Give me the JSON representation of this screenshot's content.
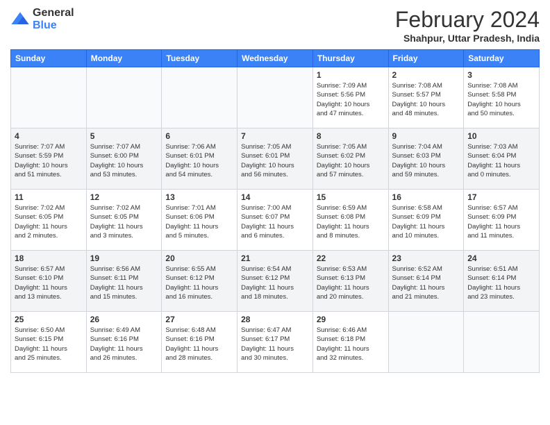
{
  "logo": {
    "general": "General",
    "blue": "Blue"
  },
  "header": {
    "month": "February 2024",
    "location": "Shahpur, Uttar Pradesh, India"
  },
  "weekdays": [
    "Sunday",
    "Monday",
    "Tuesday",
    "Wednesday",
    "Thursday",
    "Friday",
    "Saturday"
  ],
  "weeks": [
    [
      {
        "day": "",
        "info": ""
      },
      {
        "day": "",
        "info": ""
      },
      {
        "day": "",
        "info": ""
      },
      {
        "day": "",
        "info": ""
      },
      {
        "day": "1",
        "info": "Sunrise: 7:09 AM\nSunset: 5:56 PM\nDaylight: 10 hours\nand 47 minutes."
      },
      {
        "day": "2",
        "info": "Sunrise: 7:08 AM\nSunset: 5:57 PM\nDaylight: 10 hours\nand 48 minutes."
      },
      {
        "day": "3",
        "info": "Sunrise: 7:08 AM\nSunset: 5:58 PM\nDaylight: 10 hours\nand 50 minutes."
      }
    ],
    [
      {
        "day": "4",
        "info": "Sunrise: 7:07 AM\nSunset: 5:59 PM\nDaylight: 10 hours\nand 51 minutes."
      },
      {
        "day": "5",
        "info": "Sunrise: 7:07 AM\nSunset: 6:00 PM\nDaylight: 10 hours\nand 53 minutes."
      },
      {
        "day": "6",
        "info": "Sunrise: 7:06 AM\nSunset: 6:01 PM\nDaylight: 10 hours\nand 54 minutes."
      },
      {
        "day": "7",
        "info": "Sunrise: 7:05 AM\nSunset: 6:01 PM\nDaylight: 10 hours\nand 56 minutes."
      },
      {
        "day": "8",
        "info": "Sunrise: 7:05 AM\nSunset: 6:02 PM\nDaylight: 10 hours\nand 57 minutes."
      },
      {
        "day": "9",
        "info": "Sunrise: 7:04 AM\nSunset: 6:03 PM\nDaylight: 10 hours\nand 59 minutes."
      },
      {
        "day": "10",
        "info": "Sunrise: 7:03 AM\nSunset: 6:04 PM\nDaylight: 11 hours\nand 0 minutes."
      }
    ],
    [
      {
        "day": "11",
        "info": "Sunrise: 7:02 AM\nSunset: 6:05 PM\nDaylight: 11 hours\nand 2 minutes."
      },
      {
        "day": "12",
        "info": "Sunrise: 7:02 AM\nSunset: 6:05 PM\nDaylight: 11 hours\nand 3 minutes."
      },
      {
        "day": "13",
        "info": "Sunrise: 7:01 AM\nSunset: 6:06 PM\nDaylight: 11 hours\nand 5 minutes."
      },
      {
        "day": "14",
        "info": "Sunrise: 7:00 AM\nSunset: 6:07 PM\nDaylight: 11 hours\nand 6 minutes."
      },
      {
        "day": "15",
        "info": "Sunrise: 6:59 AM\nSunset: 6:08 PM\nDaylight: 11 hours\nand 8 minutes."
      },
      {
        "day": "16",
        "info": "Sunrise: 6:58 AM\nSunset: 6:09 PM\nDaylight: 11 hours\nand 10 minutes."
      },
      {
        "day": "17",
        "info": "Sunrise: 6:57 AM\nSunset: 6:09 PM\nDaylight: 11 hours\nand 11 minutes."
      }
    ],
    [
      {
        "day": "18",
        "info": "Sunrise: 6:57 AM\nSunset: 6:10 PM\nDaylight: 11 hours\nand 13 minutes."
      },
      {
        "day": "19",
        "info": "Sunrise: 6:56 AM\nSunset: 6:11 PM\nDaylight: 11 hours\nand 15 minutes."
      },
      {
        "day": "20",
        "info": "Sunrise: 6:55 AM\nSunset: 6:12 PM\nDaylight: 11 hours\nand 16 minutes."
      },
      {
        "day": "21",
        "info": "Sunrise: 6:54 AM\nSunset: 6:12 PM\nDaylight: 11 hours\nand 18 minutes."
      },
      {
        "day": "22",
        "info": "Sunrise: 6:53 AM\nSunset: 6:13 PM\nDaylight: 11 hours\nand 20 minutes."
      },
      {
        "day": "23",
        "info": "Sunrise: 6:52 AM\nSunset: 6:14 PM\nDaylight: 11 hours\nand 21 minutes."
      },
      {
        "day": "24",
        "info": "Sunrise: 6:51 AM\nSunset: 6:14 PM\nDaylight: 11 hours\nand 23 minutes."
      }
    ],
    [
      {
        "day": "25",
        "info": "Sunrise: 6:50 AM\nSunset: 6:15 PM\nDaylight: 11 hours\nand 25 minutes."
      },
      {
        "day": "26",
        "info": "Sunrise: 6:49 AM\nSunset: 6:16 PM\nDaylight: 11 hours\nand 26 minutes."
      },
      {
        "day": "27",
        "info": "Sunrise: 6:48 AM\nSunset: 6:16 PM\nDaylight: 11 hours\nand 28 minutes."
      },
      {
        "day": "28",
        "info": "Sunrise: 6:47 AM\nSunset: 6:17 PM\nDaylight: 11 hours\nand 30 minutes."
      },
      {
        "day": "29",
        "info": "Sunrise: 6:46 AM\nSunset: 6:18 PM\nDaylight: 11 hours\nand 32 minutes."
      },
      {
        "day": "",
        "info": ""
      },
      {
        "day": "",
        "info": ""
      }
    ]
  ]
}
